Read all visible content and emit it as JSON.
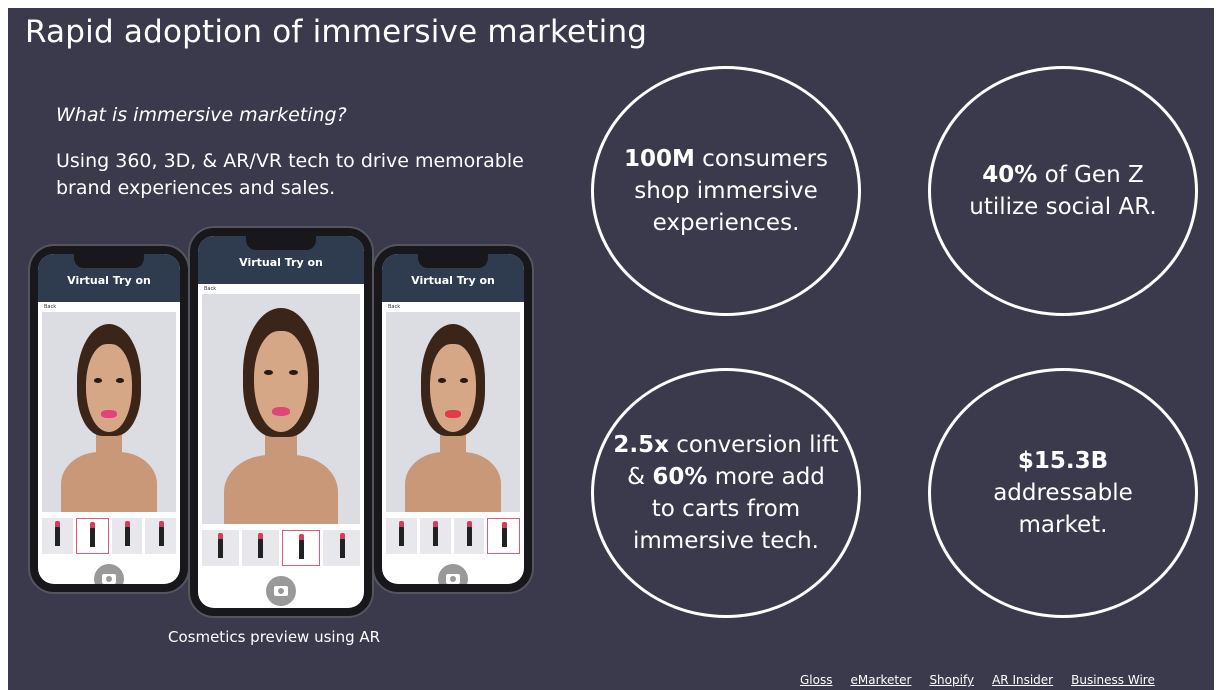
{
  "title": "Rapid adoption of immersive marketing",
  "question": "What is immersive marketing?",
  "description": "Using 360, 3D, & AR/VR tech to drive memorable brand experiences and sales.",
  "phones": {
    "header_label": "Virtual Try on",
    "back_label": "Back"
  },
  "caption": "Cosmetics preview using AR",
  "stats": {
    "consumers": {
      "bold": "100M",
      "rest": " consumers shop immersive experiences."
    },
    "genz": {
      "bold": "40%",
      "rest": " of Gen Z utilize social AR."
    },
    "conversion": {
      "bold1": "2.5x",
      "mid": " conversion lift & ",
      "bold2": "60%",
      "rest": " more add to carts from immersive tech."
    },
    "market": {
      "bold": "$15.3B",
      "rest": "addressable market."
    }
  },
  "sources": [
    "Gloss",
    "eMarketer",
    "Shopify",
    "AR Insider",
    "Business Wire"
  ],
  "colors": {
    "background": "#3a3a4c",
    "accent": "#e05a77"
  }
}
